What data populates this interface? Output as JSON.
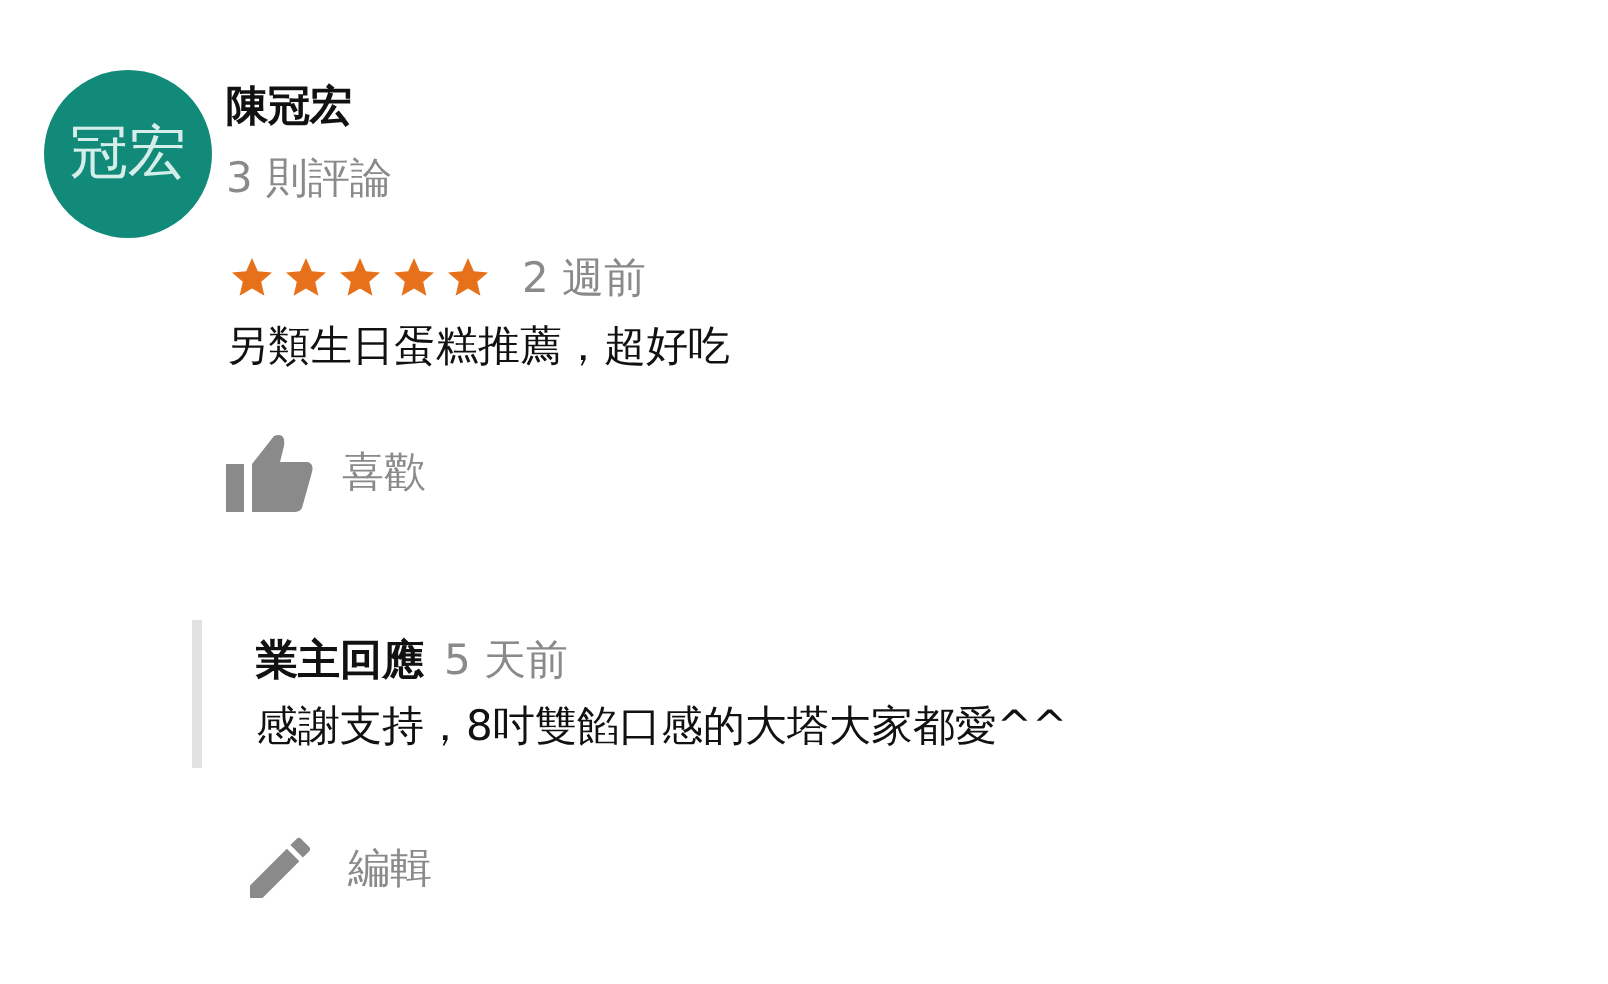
{
  "review": {
    "avatar_text": "冠宏",
    "author": "陳冠宏",
    "review_count": "3 則評論",
    "stars": 5,
    "time": "2 週前",
    "text": "另類生日蛋糕推薦，超好吃",
    "like_label": "喜歡"
  },
  "owner_reply": {
    "title": "業主回應",
    "time": "5 天前",
    "text": "感謝支持，8吋雙餡口感的大塔大家都愛^^"
  },
  "edit_label": "編輯"
}
